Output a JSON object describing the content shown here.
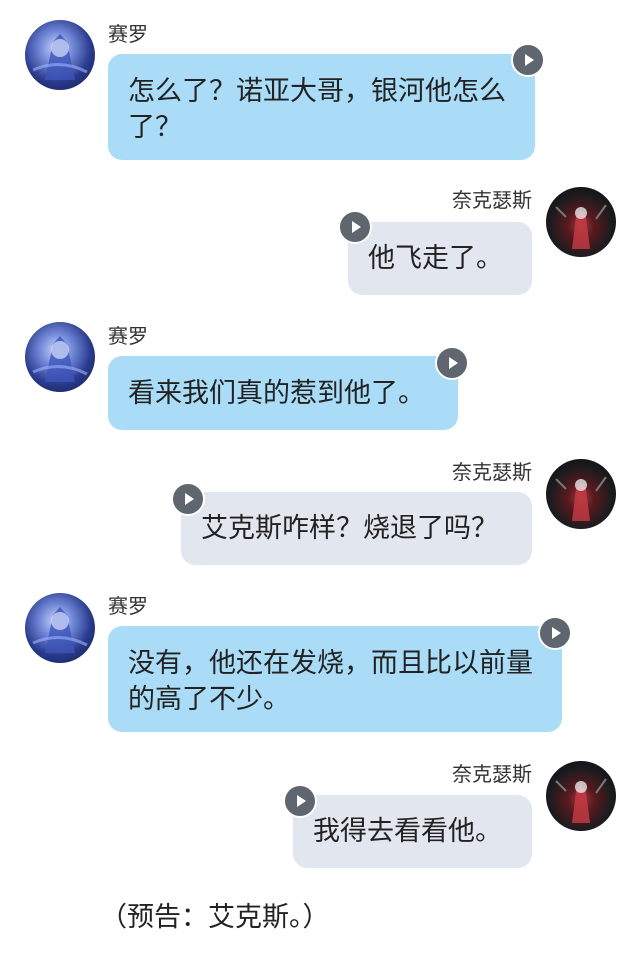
{
  "chat": {
    "messages": [
      {
        "sender": "赛罗",
        "side": "left",
        "text": "怎么了？诺亚大哥，银河他怎么\n了？",
        "avatar": "zero-avatar"
      },
      {
        "sender": "奈克瑟斯",
        "side": "right",
        "text": "他飞走了。",
        "avatar": "nexus-avatar"
      },
      {
        "sender": "赛罗",
        "side": "left",
        "text": "看来我们真的惹到他了。",
        "avatar": "zero-avatar"
      },
      {
        "sender": "奈克瑟斯",
        "side": "right",
        "text": "艾克斯咋样？烧退了吗？",
        "avatar": "nexus-avatar"
      },
      {
        "sender": "赛罗",
        "side": "left",
        "text": "没有，他还在发烧，而且比以前量\n的高了不少。",
        "avatar": "zero-avatar"
      },
      {
        "sender": "奈克瑟斯",
        "side": "right",
        "text": "我得去看看他。",
        "avatar": "nexus-avatar"
      }
    ]
  },
  "caption": "（预告：艾克斯。）",
  "colors": {
    "left_bubble": "#aadcf7",
    "right_bubble": "#e2e7ef",
    "play_button": "#5f6670"
  },
  "icons": {
    "play": "play-icon"
  }
}
